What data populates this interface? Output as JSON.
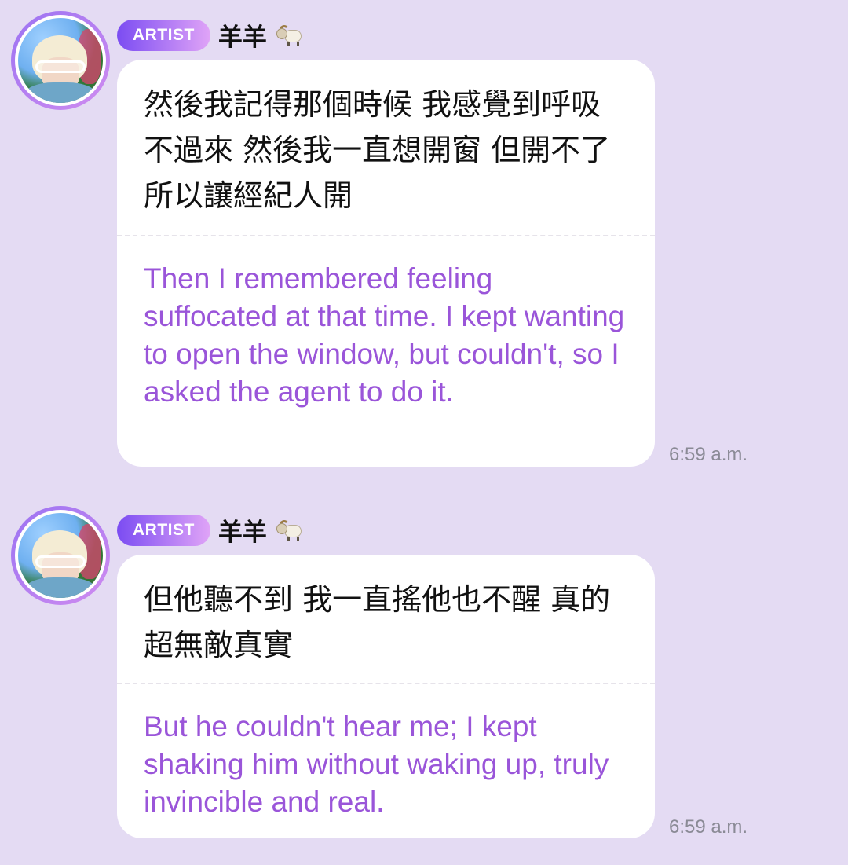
{
  "messages": [
    {
      "badge": "ARTIST",
      "sender": "羊羊",
      "sender_icon": "ram-emoji",
      "original": "然後我記得那個時候 我感覺到呼吸不過來 然後我一直想開窗 但開不了 所以讓經紀人開",
      "translation": "Then I remembered feeling suffocated at that time. I kept wanting to open the window, but couldn't, so I asked the agent to do it.",
      "time": "6:59 a.m."
    },
    {
      "badge": "ARTIST",
      "sender": "羊羊",
      "sender_icon": "ram-emoji",
      "original": "但他聽不到 我一直搖他也不醒 真的超無敵真實",
      "translation": "But he couldn't hear me; I kept shaking him without waking up, truly invincible and real.",
      "time": "6:59 a.m."
    }
  ],
  "colors": {
    "background": "#e4dbf3",
    "badge_gradient_start": "#7b4cf2",
    "badge_gradient_end": "#e0a4f7",
    "translation_text": "#9a55d9"
  }
}
